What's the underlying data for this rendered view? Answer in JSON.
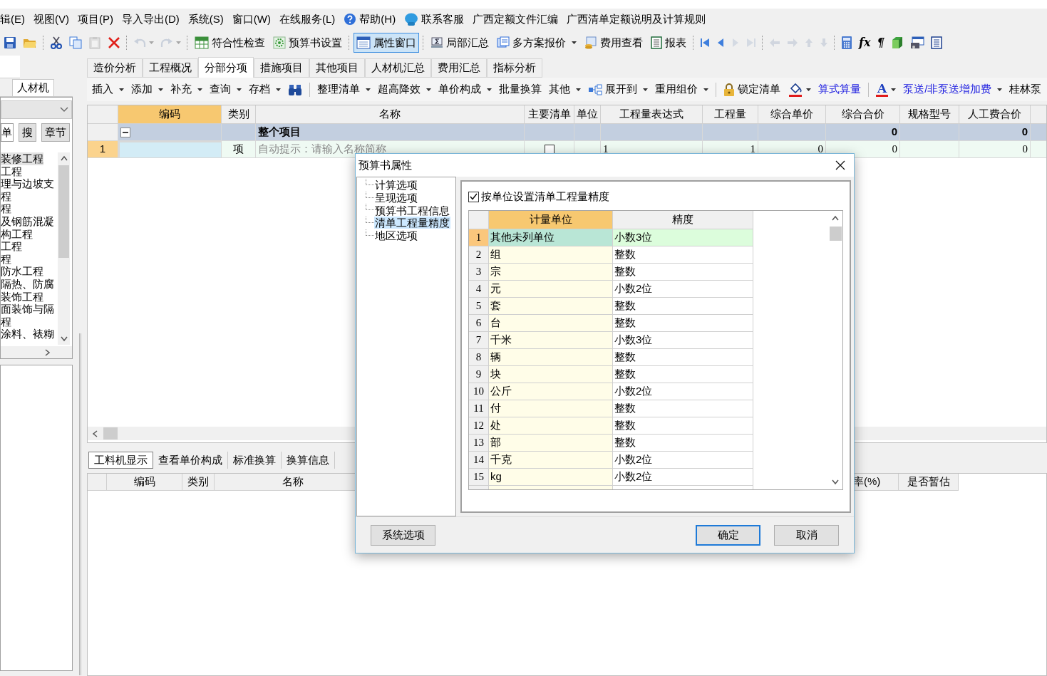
{
  "menu_bar": {
    "items": [
      "辑(E)",
      "视图(V)",
      "项目(P)",
      "导入导出(D)",
      "系统(S)",
      "窗口(W)",
      "在线服务(L)",
      "帮助(H)",
      "联系客服",
      "广西定额文件汇编",
      "广西清单定额说明及计算规则"
    ]
  },
  "toolbar": {
    "items": [
      {
        "kind": "icon",
        "disabled": false,
        "dropdown": false
      },
      {
        "kind": "icon",
        "disabled": false,
        "dropdown": false
      },
      {
        "kind": "separator"
      },
      {
        "kind": "icon",
        "disabled": false,
        "dropdown": false
      },
      {
        "kind": "icon",
        "disabled": false,
        "dropdown": false
      },
      {
        "kind": "icon",
        "disabled": true,
        "dropdown": false
      },
      {
        "kind": "icon",
        "disabled": false,
        "dropdown": false
      },
      {
        "kind": "separator"
      },
      {
        "kind": "icon",
        "disabled": true,
        "dropdown": true
      },
      {
        "kind": "icon",
        "disabled": true,
        "dropdown": true
      },
      {
        "kind": "separator"
      },
      {
        "kind": "button",
        "label": "符合性检查",
        "selected": false,
        "dropdown": false
      },
      {
        "kind": "button",
        "label": "预算书设置",
        "selected": false,
        "dropdown": false
      },
      {
        "kind": "separator"
      },
      {
        "kind": "button",
        "label": "属性窗口",
        "selected": true,
        "dropdown": false
      },
      {
        "kind": "separator"
      },
      {
        "kind": "button",
        "label": "局部汇总",
        "selected": false,
        "dropdown": false
      },
      {
        "kind": "button",
        "label": "多方案报价",
        "selected": false,
        "dropdown": true
      },
      {
        "kind": "button",
        "label": "费用查看",
        "selected": false,
        "dropdown": false
      },
      {
        "kind": "button",
        "label": "报表",
        "selected": false,
        "dropdown": false
      },
      {
        "kind": "separator"
      },
      {
        "kind": "icon",
        "disabled": false,
        "dropdown": false
      },
      {
        "kind": "icon",
        "disabled": false,
        "dropdown": false
      },
      {
        "kind": "icon",
        "disabled": true,
        "dropdown": false
      },
      {
        "kind": "icon",
        "disabled": true,
        "dropdown": false
      },
      {
        "kind": "separator"
      },
      {
        "kind": "icon",
        "disabled": true,
        "dropdown": false
      },
      {
        "kind": "icon",
        "disabled": true,
        "dropdown": false
      },
      {
        "kind": "icon",
        "disabled": true,
        "dropdown": false
      },
      {
        "kind": "icon",
        "disabled": true,
        "dropdown": false
      },
      {
        "kind": "separator"
      },
      {
        "kind": "icon",
        "disabled": false,
        "dropdown": false
      },
      {
        "kind": "symbol",
        "label": "fx"
      },
      {
        "kind": "symbol",
        "label": "¶"
      },
      {
        "kind": "icon",
        "disabled": false,
        "dropdown": false
      },
      {
        "kind": "icon",
        "disabled": false,
        "dropdown": false
      },
      {
        "kind": "icon",
        "disabled": false,
        "dropdown": false
      }
    ]
  },
  "left_panel": {
    "tab": "人材机",
    "search_value": "单",
    "buttons": [
      "搜",
      "章节"
    ],
    "tree": [
      {
        "label": "装修工程",
        "selected": true
      },
      {
        "label": "工程",
        "selected": false
      },
      {
        "label": "理与边坡支",
        "selected": false
      },
      {
        "label": "程",
        "selected": false
      },
      {
        "label": "程",
        "selected": false
      },
      {
        "label": "及钢筋混凝",
        "selected": false
      },
      {
        "label": "构工程",
        "selected": false
      },
      {
        "label": "工程",
        "selected": false
      },
      {
        "label": "程",
        "selected": false
      },
      {
        "label": "防水工程",
        "selected": false
      },
      {
        "label": "隔热、防腐",
        "selected": false
      },
      {
        "label": "装饰工程",
        "selected": false
      },
      {
        "label": "面装饰与隔",
        "selected": false
      },
      {
        "label": "程",
        "selected": false
      },
      {
        "label": "涂料、裱糊",
        "selected": false
      }
    ]
  },
  "tabs": [
    {
      "label": "造价分析",
      "selected": false
    },
    {
      "label": "工程概况",
      "selected": false
    },
    {
      "label": "分部分项",
      "selected": true
    },
    {
      "label": "措施项目",
      "selected": false
    },
    {
      "label": "其他项目",
      "selected": false
    },
    {
      "label": "人材机汇总",
      "selected": false
    },
    {
      "label": "费用汇总",
      "selected": false
    },
    {
      "label": "指标分析",
      "selected": false
    }
  ],
  "sub_toolbar": {
    "items": [
      {
        "kind": "text",
        "label": "插入",
        "dropdown": true
      },
      {
        "kind": "text",
        "label": "添加",
        "dropdown": true
      },
      {
        "kind": "text",
        "label": "补充",
        "dropdown": true
      },
      {
        "kind": "text",
        "label": "查询",
        "dropdown": true
      },
      {
        "kind": "text",
        "label": "存档",
        "dropdown": true
      },
      {
        "kind": "icon",
        "dropdown": false
      },
      {
        "kind": "separator"
      },
      {
        "kind": "text",
        "label": "整理清单",
        "dropdown": true
      },
      {
        "kind": "text",
        "label": "超高降效",
        "dropdown": true
      },
      {
        "kind": "text",
        "label": "单价构成",
        "dropdown": true
      },
      {
        "kind": "text",
        "label": "批量换算",
        "dropdown": false
      },
      {
        "kind": "text",
        "label": "其他",
        "dropdown": true
      },
      {
        "kind": "text",
        "label": "展开到",
        "dropdown": true
      },
      {
        "kind": "text",
        "label": "重用组价",
        "dropdown": true
      },
      {
        "kind": "separator"
      },
      {
        "kind": "text",
        "label": "锁定清单",
        "dropdown": false
      },
      {
        "kind": "icon",
        "dropdown": true
      },
      {
        "kind": "link",
        "label": "算式算量",
        "dropdown": false
      },
      {
        "kind": "separator"
      },
      {
        "kind": "symbol",
        "label": "A",
        "dropdown": true
      },
      {
        "kind": "link",
        "label": "泵送/非泵送增加费",
        "dropdown": true
      },
      {
        "kind": "text",
        "label": "桂林泵",
        "dropdown": false
      }
    ]
  },
  "table": {
    "columns": [
      {
        "label": "编码",
        "selected": true
      },
      {
        "label": "类别",
        "selected": false
      },
      {
        "label": "名称",
        "selected": false
      },
      {
        "label": "主要清单",
        "selected": false
      },
      {
        "label": "单位",
        "selected": false
      },
      {
        "label": "工程量表达式",
        "selected": false
      },
      {
        "label": "工程量",
        "selected": false
      },
      {
        "label": "综合单价",
        "selected": false
      },
      {
        "label": "综合合价",
        "selected": false
      },
      {
        "label": "规格型号",
        "selected": false
      },
      {
        "label": "人工费合价",
        "selected": false
      }
    ],
    "rows": [
      {
        "kind": "group",
        "expanded": true,
        "name": "整个项目",
        "total": "0",
        "labor_total": "0"
      },
      {
        "kind": "item",
        "selected": true,
        "index": "1",
        "category": "项",
        "name_placeholder": "自动提示：请输入名称简称",
        "main": false,
        "quantity_expression": "1",
        "quantity": "1",
        "unit_price": "0",
        "total": "0",
        "labor_total": "0"
      }
    ]
  },
  "bottom_tabs": [
    {
      "label": "工料机显示",
      "selected": true
    },
    {
      "label": "查看单价构成",
      "selected": false
    },
    {
      "label": "标准换算",
      "selected": false
    },
    {
      "label": "换算信息",
      "selected": false
    }
  ],
  "bottom_table": {
    "columns": [
      "编码",
      "类别",
      "名称",
      "率(%)",
      "是否暂估"
    ]
  },
  "dialog": {
    "title": "预算书属性",
    "tree": [
      {
        "label": "计算选项",
        "selected": false
      },
      {
        "label": "呈现选项",
        "selected": false
      },
      {
        "label": "预算书工程信息",
        "selected": false
      },
      {
        "label": "清单工程量精度",
        "selected": true
      },
      {
        "label": "地区选项",
        "selected": false
      }
    ],
    "checkbox": {
      "label": "按单位设置清单工程量精度",
      "checked": true
    },
    "columns": [
      {
        "label": "计量单位",
        "selected": true
      },
      {
        "label": "精度",
        "selected": false
      }
    ],
    "rows": [
      {
        "index": "1",
        "unit": "其他未列单位",
        "precision": "小数3位",
        "selected": true
      },
      {
        "index": "2",
        "unit": "组",
        "precision": "整数",
        "selected": false
      },
      {
        "index": "3",
        "unit": "宗",
        "precision": "整数",
        "selected": false
      },
      {
        "index": "4",
        "unit": "元",
        "precision": "小数2位",
        "selected": false
      },
      {
        "index": "5",
        "unit": "套",
        "precision": "整数",
        "selected": false
      },
      {
        "index": "6",
        "unit": "台",
        "precision": "整数",
        "selected": false
      },
      {
        "index": "7",
        "unit": "千米",
        "precision": "小数3位",
        "selected": false
      },
      {
        "index": "8",
        "unit": "辆",
        "precision": "整数",
        "selected": false
      },
      {
        "index": "9",
        "unit": "块",
        "precision": "整数",
        "selected": false
      },
      {
        "index": "10",
        "unit": "公斤",
        "precision": "小数2位",
        "selected": false
      },
      {
        "index": "11",
        "unit": "付",
        "precision": "整数",
        "selected": false
      },
      {
        "index": "12",
        "unit": "处",
        "precision": "整数",
        "selected": false
      },
      {
        "index": "13",
        "unit": "部",
        "precision": "整数",
        "selected": false
      },
      {
        "index": "14",
        "unit": "千克",
        "precision": "小数2位",
        "selected": false
      },
      {
        "index": "15",
        "unit": "kg",
        "precision": "小数2位",
        "selected": false
      }
    ],
    "buttons": [
      {
        "label": "系统选项",
        "default": false
      },
      {
        "label": "确定",
        "default": true
      },
      {
        "label": "取消",
        "default": false
      }
    ]
  }
}
